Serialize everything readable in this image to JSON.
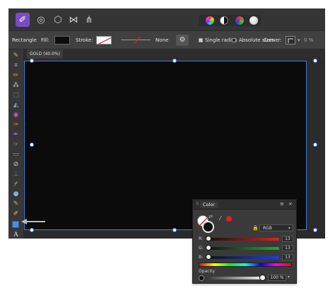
{
  "topbar": {
    "personas": [
      {
        "icon": "designer-persona-icon",
        "glyph": "✐",
        "active": true
      },
      {
        "icon": "pixel-persona-icon",
        "glyph": "◎",
        "active": false
      },
      {
        "icon": "export-persona-icon",
        "glyph": "⬡",
        "active": false
      },
      {
        "icon": "distribute-icon",
        "glyph": "⋈",
        "active": false
      },
      {
        "icon": "share-icon",
        "glyph": "⋔",
        "active": false
      }
    ],
    "modes": [
      "color-wheel-mode-icon",
      "contrast-mode-icon",
      "rgb-mode-icon",
      "white-mode-icon"
    ]
  },
  "context": {
    "shape_name": "Rectangle",
    "fill_label": "Fill:",
    "stroke_label": "Stroke:",
    "stroke_value": "None",
    "single_radius_label": "Single radius",
    "single_radius_checked": true,
    "absolute_sizes_label": "Absolute sizes",
    "absolute_sizes_checked": false,
    "corner_label": "Corner:",
    "corner_value": "0 %",
    "fill_color": "#0d0d0d",
    "stroke_color": "#ffffff"
  },
  "document": {
    "tab_label": "GOLD (40.0%)"
  },
  "tools": [
    "pen-tool-icon",
    "crop-tool-icon",
    "brush-tool-icon",
    "magic-wand-icon",
    "marquee-select-icon",
    "fill-bucket-icon",
    "color-picker-icon",
    "paint-brush-icon",
    "retouch-brush-icon",
    "smudge-icon",
    "eraser-icon",
    "dodge-tool-icon",
    "stamp-tool-icon",
    "dropper-icon",
    "blur-tool-icon",
    "pencil-tool-icon",
    "rectangle-tool-icon",
    "text-tool-icon"
  ],
  "color_panel": {
    "title": "Color",
    "model": "RGB",
    "sliders": [
      {
        "label": "R:",
        "value": "13",
        "color": "#e02020"
      },
      {
        "label": "G:",
        "value": "13",
        "color": "#20b020"
      },
      {
        "label": "B:",
        "value": "13",
        "color": "#2040e0"
      }
    ],
    "opacity_label": "Opacity",
    "opacity_value": "100 %",
    "current_color": "#0d0d0d"
  }
}
